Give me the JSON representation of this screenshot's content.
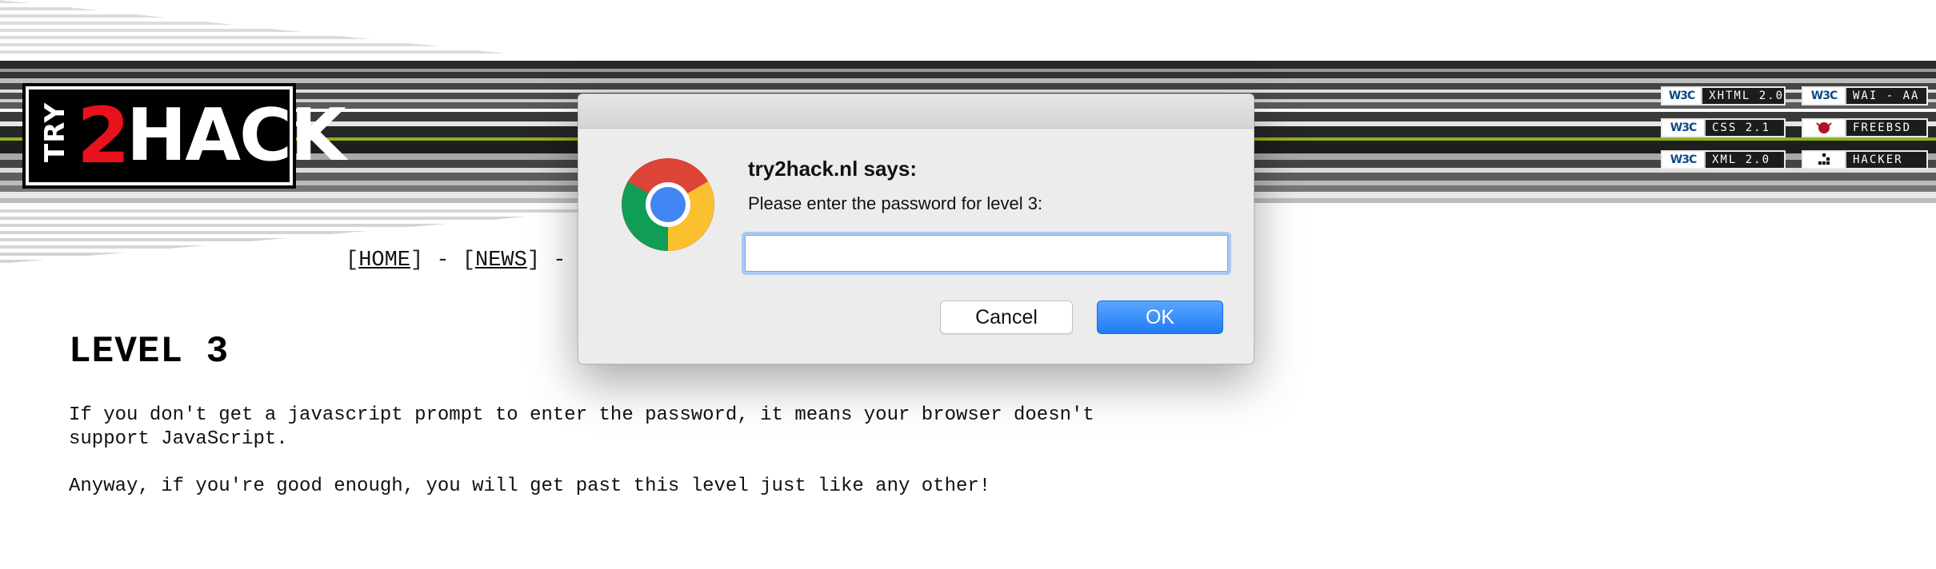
{
  "logo": {
    "try_text": "TRY",
    "two_text": "2",
    "hack_text": "HACK"
  },
  "badges": [
    {
      "left": "W3C",
      "label": "XHTML 2.0",
      "icon": "w3c-icon"
    },
    {
      "left": "W3C",
      "label": "WAI - AA",
      "icon": "w3c-icon"
    },
    {
      "left": "W3C",
      "label": "CSS 2.1",
      "icon": "w3c-icon"
    },
    {
      "left": "",
      "label": "FREEBSD",
      "icon": "freebsd-daemon-icon"
    },
    {
      "left": "W3C",
      "label": "XML 2.0",
      "icon": "w3c-icon"
    },
    {
      "left": "",
      "label": "HACKER",
      "icon": "glider-icon"
    }
  ],
  "nav": {
    "open": "[",
    "home": "HOME",
    "close_sep": "] - [",
    "news": "NEWS",
    "trail": "] -"
  },
  "page": {
    "title": "LEVEL 3",
    "para1": "If you don't get a javascript prompt to enter the password, it means your browser doesn't\nsupport JavaScript.",
    "para2": "Anyway, if you're good enough, you will get past this level just like any other!"
  },
  "dialog": {
    "title": "try2hack.nl says:",
    "message": "Please enter the password for level 3:",
    "input_value": "",
    "cancel_label": "Cancel",
    "ok_label": "OK",
    "icon": "chrome-icon"
  },
  "colors": {
    "ok_button": "#1f7cf4",
    "logo_red": "#e8121c",
    "stripe_green": "#8fb21d"
  }
}
